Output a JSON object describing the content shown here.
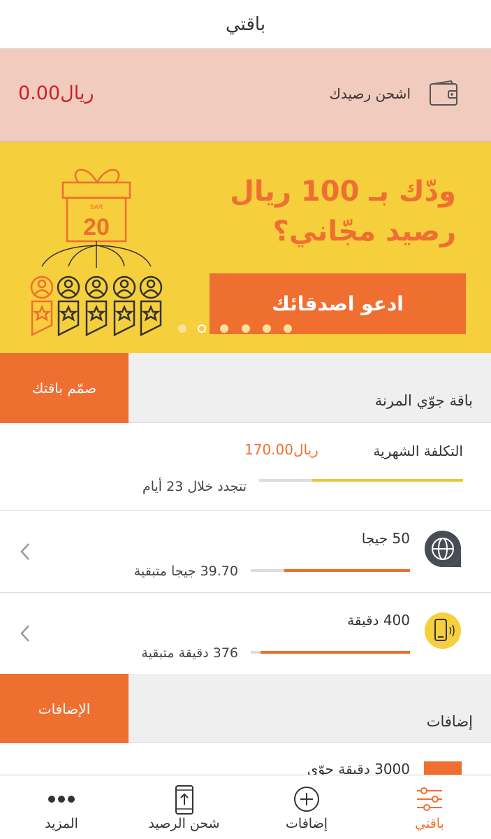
{
  "header": {
    "title": "باقتي"
  },
  "balance": {
    "topup_label": "اشحن رصيدك",
    "amount": "0.00ريال"
  },
  "banner": {
    "line1": "ودّك بـ 100 ريال",
    "line2": "رصيد مجّاني؟",
    "invite_button": "ادعو اصدقائك",
    "gift_currency": "SAR",
    "gift_value": "20",
    "dots_count": 7,
    "active_dot_index": 1
  },
  "plan": {
    "design_button": "صمّم باقتك",
    "title": "باقة جوّي المرنة",
    "monthly_cost_label": "التكلفة الشهرية",
    "monthly_cost_value": "170.00ريال",
    "renew_text": "تتجدد خلال 23 أيام",
    "renew_progress": 0.74
  },
  "usage": [
    {
      "amount": "50 جيجا",
      "remaining": "39.70 جيجا متبقية",
      "icon": "globe-icon",
      "progress": 0.79
    },
    {
      "amount": "400 دقيقة",
      "remaining": "376 دقيقة متبقية",
      "icon": "phone-icon",
      "progress": 0.94
    }
  ],
  "addons": {
    "button": "الإضافات",
    "title": "إضافات",
    "item_label": "3000 دقيقة جوّي"
  },
  "tabbar": {
    "items": [
      {
        "label": "باقتي",
        "icon": "sliders-icon",
        "active": true
      },
      {
        "label": "إضافات",
        "icon": "plus-circle-icon",
        "active": false
      },
      {
        "label": "شحن الرصيد",
        "icon": "phone-upload-icon",
        "active": false
      },
      {
        "label": "المزيد",
        "icon": "more-dots-icon",
        "active": false
      }
    ]
  },
  "colors": {
    "accent": "#ef6f31",
    "yellow": "#f6cf3c",
    "balance_bg": "#f1cbbd",
    "price_red": "#c8202b"
  }
}
